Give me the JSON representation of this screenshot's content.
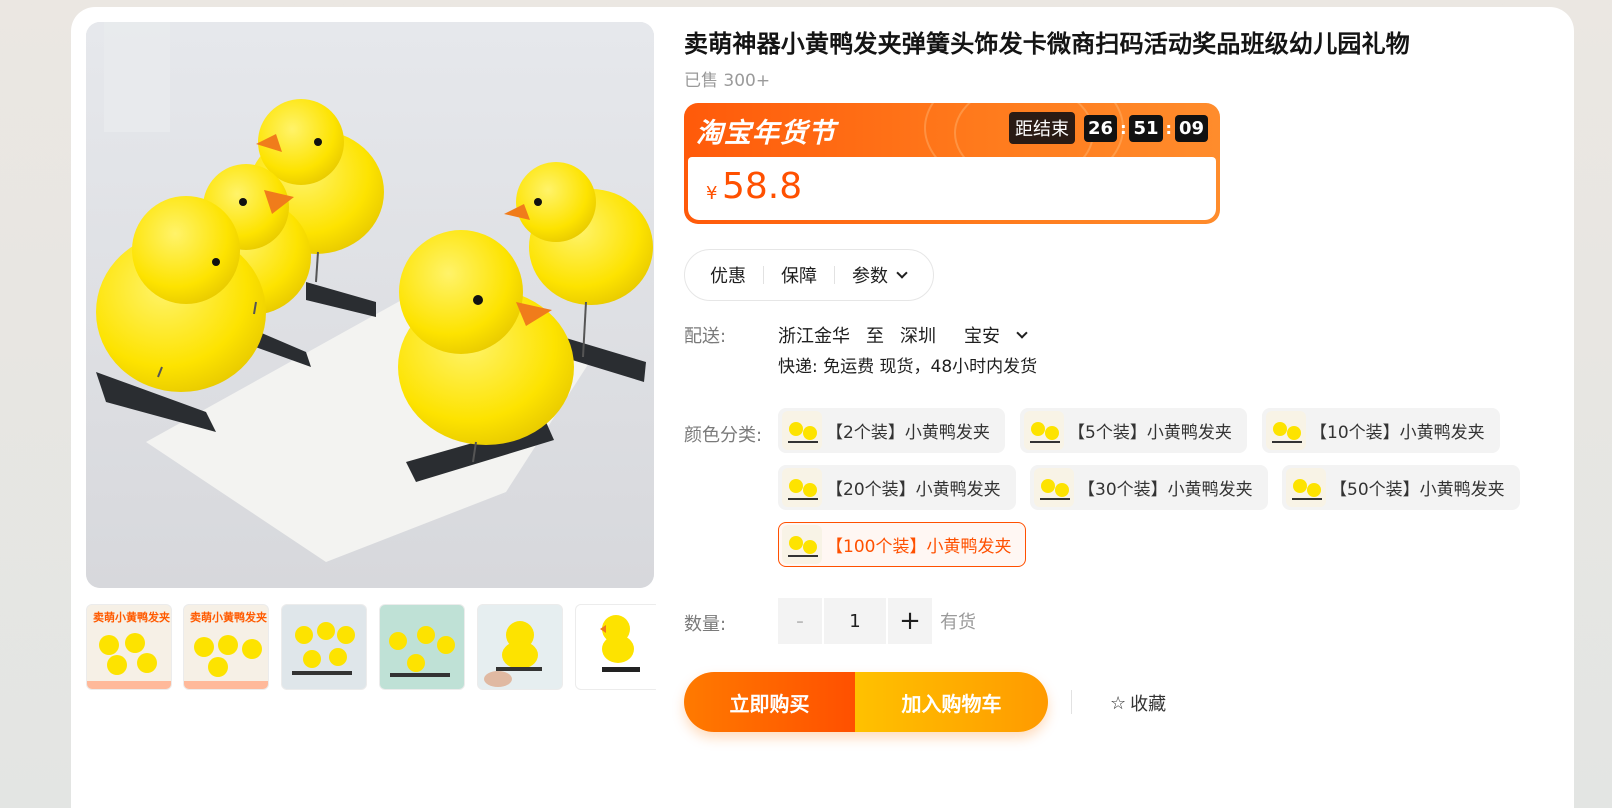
{
  "product": {
    "title": "卖萌神器小黄鸭发夹弹簧头饰发卡微商扫码活动奖品班级幼儿园礼物",
    "sold": "已售 300+"
  },
  "promo": {
    "title": "淘宝年货节",
    "countdown_label": "距结束",
    "hours": "26",
    "minutes": "51",
    "seconds": "09",
    "sep": ":",
    "currency": "¥",
    "price": "58.8",
    "accent": "#ff5000"
  },
  "tabs": {
    "discount": "优惠",
    "guarantee": "保障",
    "params": "参数"
  },
  "shipping": {
    "label": "配送:",
    "from": "浙江金华",
    "to_word": "至",
    "city": "深圳",
    "district": "宝安",
    "line2": "快递: 免运费  现货，48小时内发货"
  },
  "sku": {
    "label": "颜色分类:",
    "options": [
      "【2个装】小黄鸭发夹",
      "【5个装】小黄鸭发夹",
      "【10个装】小黄鸭发夹",
      "【20个装】小黄鸭发夹",
      "【30个装】小黄鸭发夹",
      "【50个装】小黄鸭发夹",
      "【100个装】小黄鸭发夹"
    ]
  },
  "quantity": {
    "label": "数量:",
    "minus": "-",
    "value": "1",
    "plus": "+",
    "stock": "有货"
  },
  "actions": {
    "buy": "立即购买",
    "cart": "加入购物车",
    "favorite": "收藏",
    "favorite_icon": "☆"
  },
  "thumbnails": [
    {
      "caption": "卖萌小黄鸭发夹"
    },
    {
      "caption": "卖萌小黄鸭发夹"
    },
    {
      "caption": ""
    },
    {
      "caption": ""
    },
    {
      "caption": ""
    },
    {
      "caption": ""
    }
  ]
}
